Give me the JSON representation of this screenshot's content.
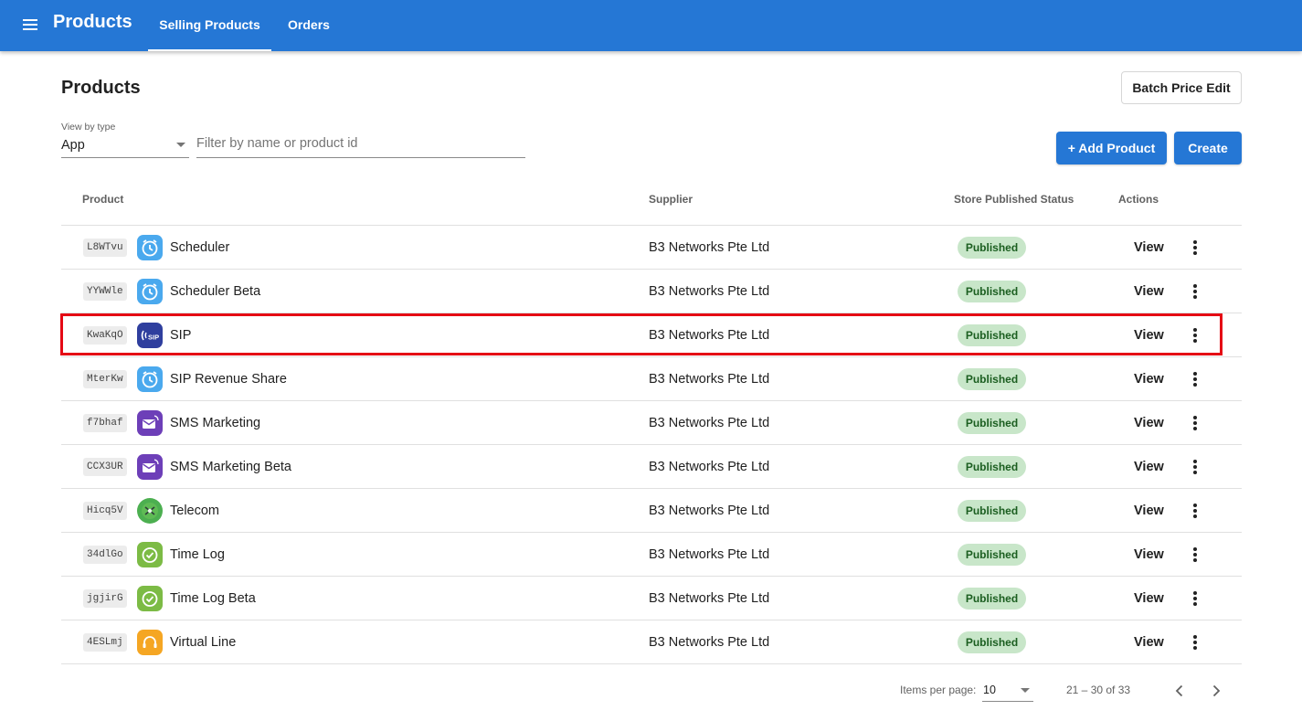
{
  "header": {
    "menu_icon": "hamburger-menu-icon",
    "title": "Products",
    "tabs": [
      {
        "label": "Selling Products",
        "active": true
      },
      {
        "label": "Orders",
        "active": false
      }
    ],
    "color": "#2577d5"
  },
  "page": {
    "title": "Products",
    "batch_price_edit_label": "Batch Price Edit",
    "add_product_label": "+ Add Product",
    "create_label": "Create"
  },
  "filters": {
    "type_label": "View by type",
    "type_value": "App",
    "search_placeholder": "Filter by name or product id",
    "search_value": ""
  },
  "table": {
    "headers": {
      "product": "Product",
      "supplier": "Supplier",
      "status": "Store Published Status",
      "actions": "Actions"
    },
    "view_label": "View",
    "rows": [
      {
        "id": "L8WTvu",
        "name": "Scheduler",
        "icon": "scheduler-clock-icon",
        "supplier": "B3 Networks Pte Ltd",
        "status": "Published"
      },
      {
        "id": "YYWWle",
        "name": "Scheduler Beta",
        "icon": "scheduler-clock-icon",
        "supplier": "B3 Networks Pte Ltd",
        "status": "Published"
      },
      {
        "id": "KwaKqO",
        "name": "SIP",
        "icon": "sip-phone-icon",
        "supplier": "B3 Networks Pte Ltd",
        "status": "Published"
      },
      {
        "id": "MterKw",
        "name": "SIP Revenue Share",
        "icon": "scheduler-clock-icon",
        "supplier": "B3 Networks Pte Ltd",
        "status": "Published"
      },
      {
        "id": "f7bhaf",
        "name": "SMS Marketing",
        "icon": "sms-envelope-icon",
        "supplier": "B3 Networks Pte Ltd",
        "status": "Published"
      },
      {
        "id": "CCX3UR",
        "name": "SMS Marketing Beta",
        "icon": "sms-envelope-icon",
        "supplier": "B3 Networks Pte Ltd",
        "status": "Published"
      },
      {
        "id": "Hicq5V",
        "name": "Telecom",
        "icon": "telecom-globe-icon",
        "supplier": "B3 Networks Pte Ltd",
        "status": "Published"
      },
      {
        "id": "34dlGo",
        "name": "Time Log",
        "icon": "timelog-clock-icon",
        "supplier": "B3 Networks Pte Ltd",
        "status": "Published"
      },
      {
        "id": "jgjirG",
        "name": "Time Log Beta",
        "icon": "timelog-clock-icon",
        "supplier": "B3 Networks Pte Ltd",
        "status": "Published"
      },
      {
        "id": "4ESLmj",
        "name": "Virtual Line",
        "icon": "headset-icon",
        "supplier": "B3 Networks Pte Ltd",
        "status": "Published"
      }
    ],
    "highlighted_row": "SIP"
  },
  "paginator": {
    "items_per_page_label": "Items per page:",
    "items_per_page": "10",
    "range": "21 – 30 of 33",
    "prev_icon": "chevron-left-icon",
    "next_icon": "chevron-right-icon"
  },
  "colors": {
    "primary": "#2577d5",
    "badge_bg": "#c8e6c9",
    "badge_text": "#1b5e20",
    "highlight": "#e50914"
  }
}
